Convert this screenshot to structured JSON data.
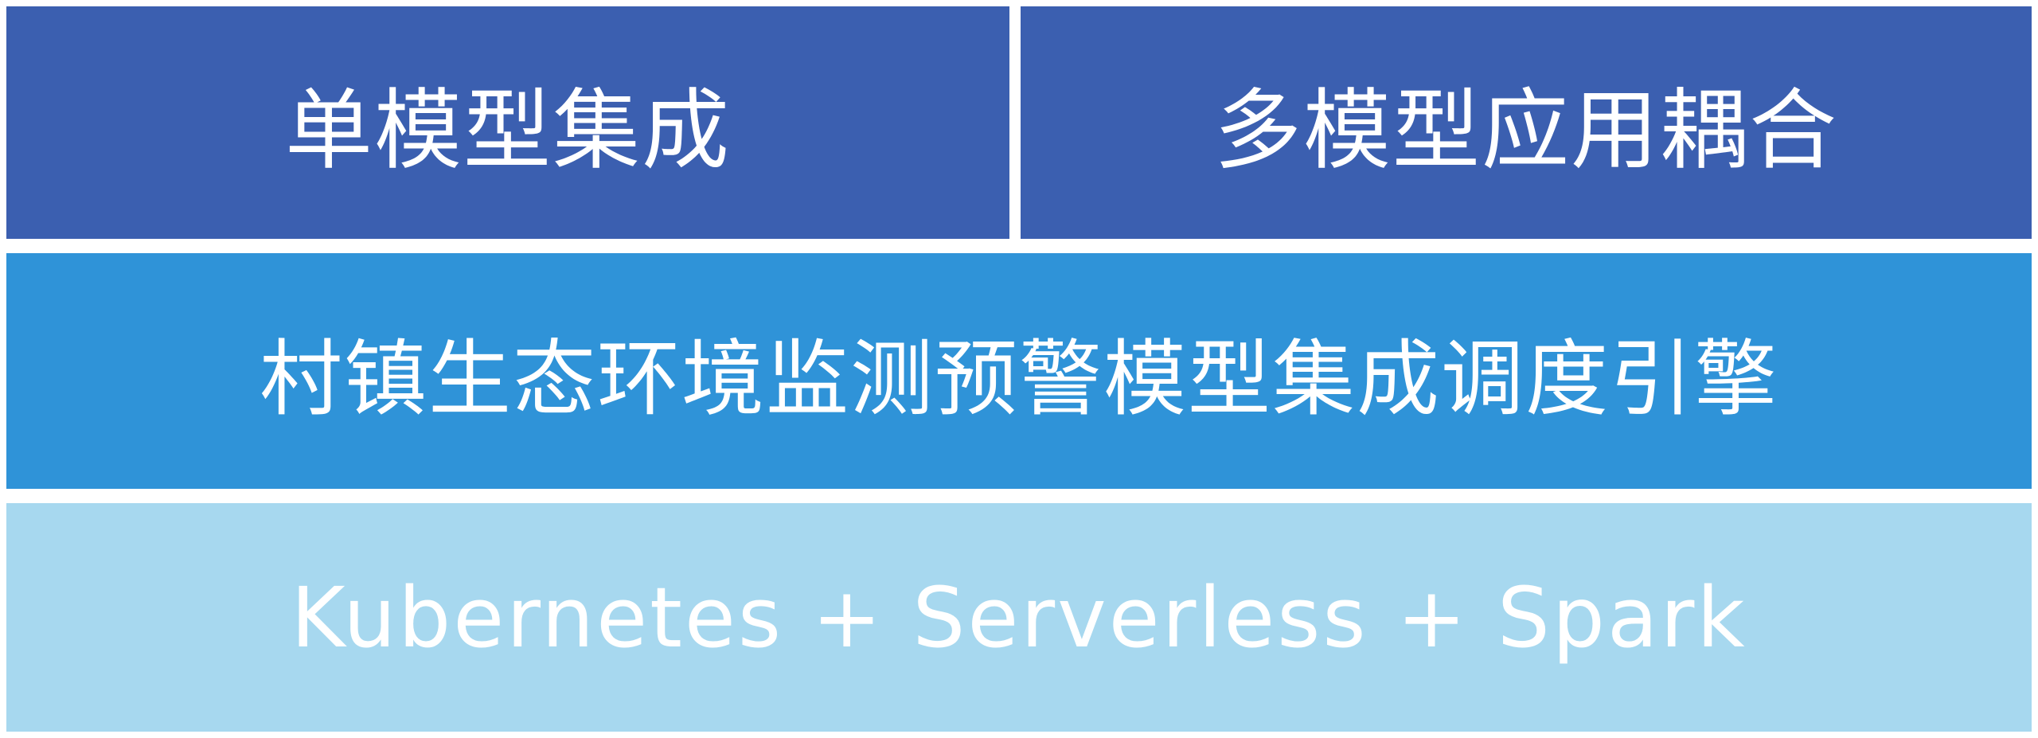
{
  "layers": {
    "top_left": "单模型集成",
    "top_right": "多模型应用耦合",
    "middle": "村镇生态环境监测预警模型集成调度引擎",
    "bottom": "Kubernetes + Serverless + Spark"
  },
  "colors": {
    "top": "#3b5fb0",
    "middle": "#2f93d8",
    "bottom": "#a7d8ef",
    "text": "#ffffff"
  }
}
